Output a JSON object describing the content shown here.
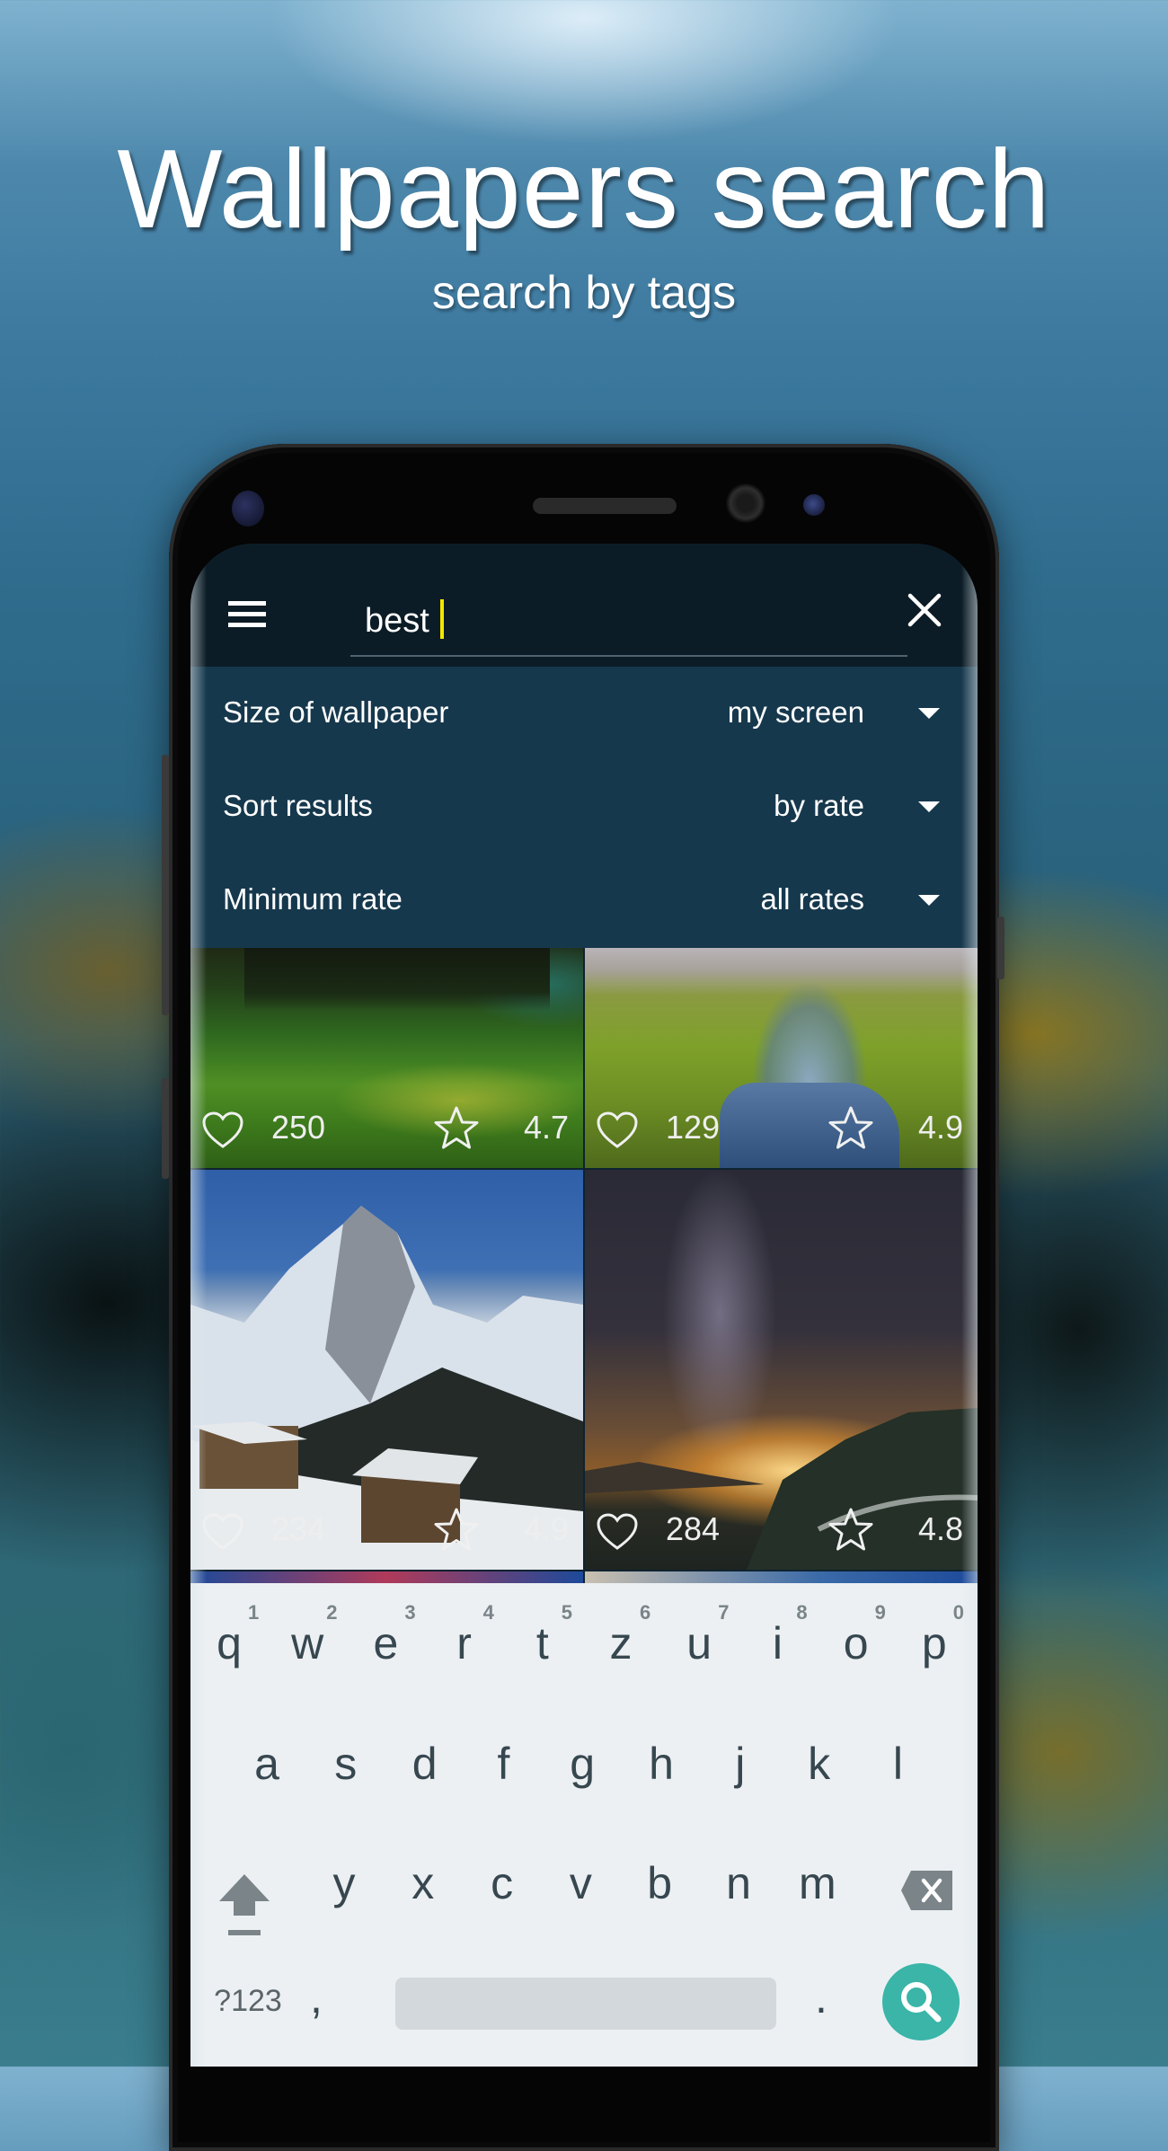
{
  "hero": {
    "title": "Wallpapers search",
    "subtitle": "search by tags"
  },
  "app": {
    "search": {
      "value": "best",
      "menu_icon": "hamburger-menu-icon",
      "clear_icon": "close-icon",
      "caret_color": "#f2e600"
    },
    "filters": [
      {
        "label": "Size of wallpaper",
        "value": "my screen"
      },
      {
        "label": "Sort results",
        "value": "by rate"
      },
      {
        "label": "Minimum rate",
        "value": "all rates"
      }
    ],
    "results": [
      {
        "scene": "green meadow with forest",
        "likes": "250",
        "rating": "4.7"
      },
      {
        "scene": "river through green grassland",
        "likes": "129",
        "rating": "4.9"
      },
      {
        "scene": "snowy mountain with wooden huts",
        "likes": "234",
        "rating": "4.9"
      },
      {
        "scene": "milky way night sky over lake",
        "likes": "284",
        "rating": "4.8"
      }
    ]
  },
  "keyboard": {
    "row1": [
      "q",
      "w",
      "e",
      "r",
      "t",
      "z",
      "u",
      "i",
      "o",
      "p"
    ],
    "row1_hints": [
      "1",
      "2",
      "3",
      "4",
      "5",
      "6",
      "7",
      "8",
      "9",
      "0"
    ],
    "row2": [
      "a",
      "s",
      "d",
      "f",
      "g",
      "h",
      "j",
      "k",
      "l"
    ],
    "row3": [
      "y",
      "x",
      "c",
      "v",
      "b",
      "n",
      "m"
    ],
    "symbols_label": "?123",
    "comma": ",",
    "period": ".",
    "action_color": "#3ab5a8"
  }
}
